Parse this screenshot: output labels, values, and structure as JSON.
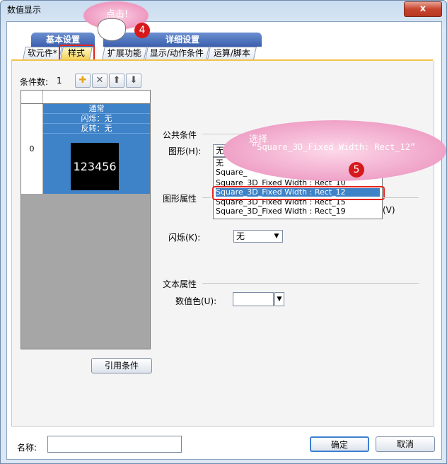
{
  "window": {
    "title": "数值显示",
    "close_glyph": "x"
  },
  "tab_groups": {
    "basic": "基本设置",
    "detail": "详细设置"
  },
  "tabs": [
    "软元件*",
    "样式",
    "扩展功能",
    "显示/动作条件",
    "运算/脚本"
  ],
  "condition": {
    "label": "条件数:",
    "count": "1",
    "icons": [
      "add-icon",
      "delete-icon",
      "up-arrow-icon",
      "down-arrow-icon"
    ]
  },
  "grid": {
    "row_index": "0",
    "lines": [
      "通常",
      "闪烁：无",
      "反转：无"
    ],
    "preview_value": "123456"
  },
  "common": {
    "section_label": "公共条件",
    "shape_label": "图形(H):",
    "shape_value": "无",
    "dropdown_options": [
      "无",
      "Square_",
      "Square_3D_Fixed Width : Rect_10",
      "Square_3D_Fixed Width : Rect_12",
      "Square_3D_Fixed Width : Rect_15",
      "Square_3D_Fixed Width : Rect_19"
    ],
    "selected_index": 3
  },
  "shape_attr": {
    "section_label": "图形属性",
    "partial_label": "(V)",
    "blink_label": "闪烁(K):",
    "blink_value": "无"
  },
  "text_attr": {
    "section_label": "文本属性",
    "color_label": "数值色(U):"
  },
  "cite_button": "引用条件",
  "footer": {
    "name_label": "名称:",
    "ok": "确定",
    "cancel": "取消"
  },
  "callouts": {
    "click": {
      "text": "点击!",
      "number": "4"
    },
    "select": {
      "line1": "选择",
      "line2": "“Square_3D_Fixed Width: Rect_12”",
      "number": "5"
    }
  },
  "colors": {
    "accent": "#3e82c8",
    "callout": "#e97fb0",
    "highlight": "#e0241f"
  }
}
